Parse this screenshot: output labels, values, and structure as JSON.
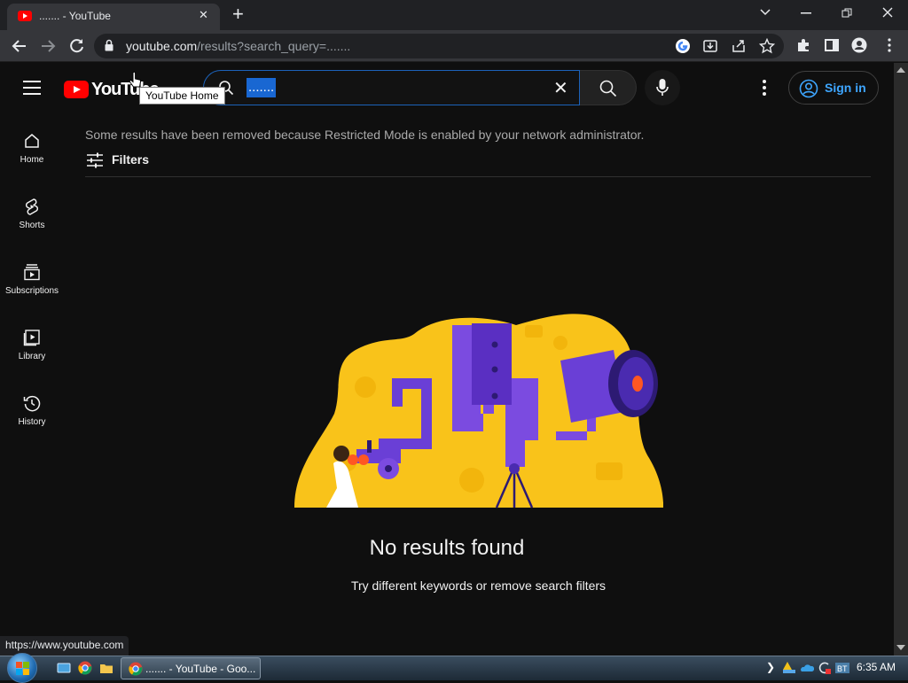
{
  "browser": {
    "tab_title": "....... - YouTube",
    "tab_close": "✕",
    "new_tab": "+",
    "url_host": "youtube.com",
    "url_rest": "/results?search_query=.......",
    "status_url": "https://www.youtube.com"
  },
  "youtube": {
    "logo_text": "YouTube",
    "tooltip": "YouTube Home",
    "search_query": ".......",
    "search_clear": "✕",
    "signin_label": "Sign in",
    "sidebar": [
      {
        "label": "Home",
        "icon": "home-icon"
      },
      {
        "label": "Shorts",
        "icon": "shorts-icon"
      },
      {
        "label": "Subscriptions",
        "icon": "subscriptions-icon"
      },
      {
        "label": "Library",
        "icon": "library-icon"
      },
      {
        "label": "History",
        "icon": "history-icon"
      }
    ],
    "notice": "Some results have been removed because Restricted Mode is enabled by your network administrator.",
    "filters_label": "Filters",
    "no_results_title": "No results found",
    "no_results_hint": "Try different keywords or remove search filters",
    "colors": {
      "accent_blue": "#3ea6ff",
      "brand_red": "#ff0000",
      "illustration_yellow": "#f9c31a",
      "illustration_purple": "#6a3fd6"
    }
  },
  "taskbar": {
    "task_chrome_label": "....... - YouTube - Goo...",
    "tray_chevron": "❯",
    "clock": "6:35 AM"
  }
}
